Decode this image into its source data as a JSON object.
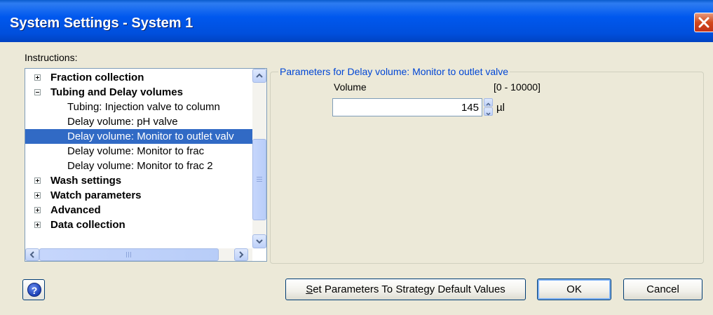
{
  "window": {
    "title": "System Settings - System 1"
  },
  "instructions": {
    "label": "Instructions:",
    "tree": [
      {
        "label": "Fraction collection",
        "level": 0,
        "expanded": false,
        "bold": true,
        "selected": false
      },
      {
        "label": "Tubing and Delay volumes",
        "level": 0,
        "expanded": true,
        "bold": true,
        "selected": false
      },
      {
        "label": "Tubing: Injection valve to column",
        "level": 1,
        "bold": false,
        "selected": false
      },
      {
        "label": "Delay volume: pH valve",
        "level": 1,
        "bold": false,
        "selected": false
      },
      {
        "label": "Delay volume: Monitor to outlet valv",
        "level": 1,
        "bold": false,
        "selected": true
      },
      {
        "label": "Delay volume: Monitor to frac",
        "level": 1,
        "bold": false,
        "selected": false
      },
      {
        "label": "Delay volume: Monitor to frac 2",
        "level": 1,
        "bold": false,
        "selected": false
      },
      {
        "label": "Wash settings",
        "level": 0,
        "expanded": false,
        "bold": true,
        "selected": false
      },
      {
        "label": "Watch parameters",
        "level": 0,
        "expanded": false,
        "bold": true,
        "selected": false
      },
      {
        "label": "Advanced",
        "level": 0,
        "expanded": false,
        "bold": true,
        "selected": false
      },
      {
        "label": "Data collection",
        "level": 0,
        "expanded": false,
        "bold": true,
        "selected": false
      }
    ]
  },
  "parameters": {
    "group_title": "Parameters for Delay volume: Monitor to outlet valve",
    "volume_label": "Volume",
    "volume_range": "[0 - 10000]",
    "volume_value": "145",
    "volume_unit": "µl"
  },
  "buttons": {
    "set_defaults_mnemonic": "S",
    "set_defaults_rest": "et Parameters To Strategy Default Values",
    "ok": "OK",
    "cancel": "Cancel"
  },
  "icons": {
    "close": "close-icon",
    "help": "help-icon",
    "expand": "plus-icon",
    "collapse": "minus-icon"
  },
  "colors": {
    "title_bar": "#0058ee",
    "selection": "#316ac5",
    "group_title": "#0046d5",
    "dialog_bg": "#ece9d8"
  }
}
